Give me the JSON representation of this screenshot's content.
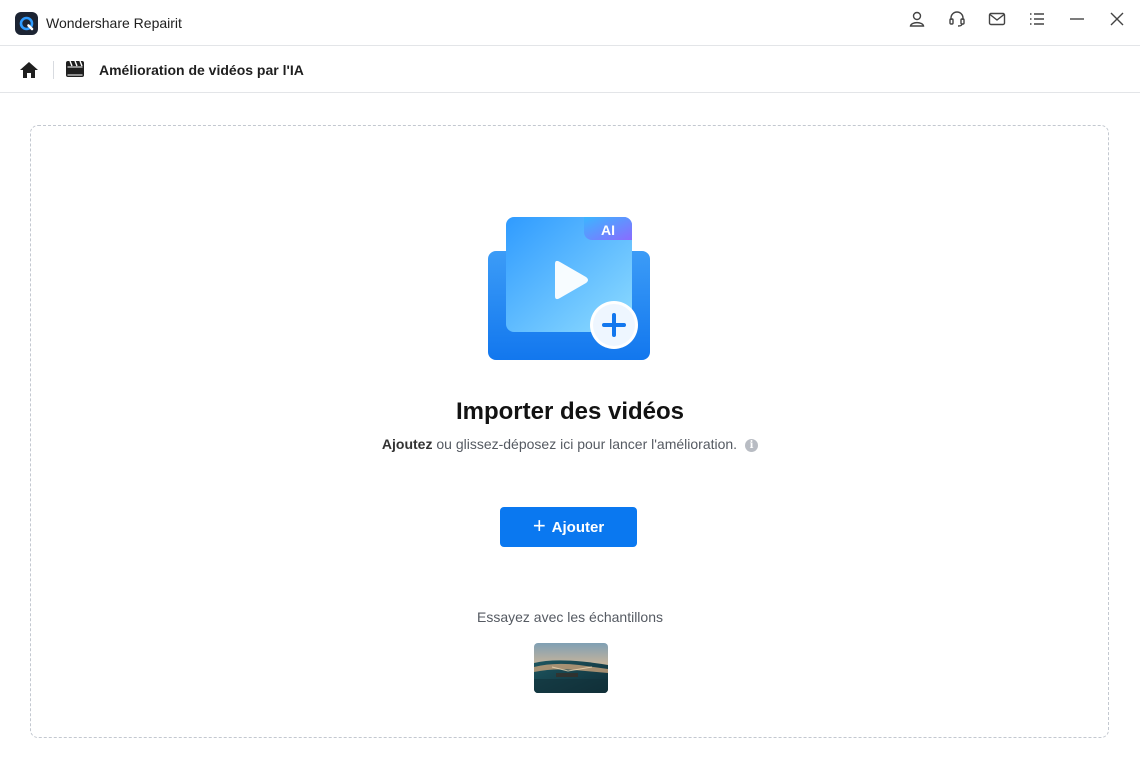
{
  "window": {
    "title": "Wondershare Repairit",
    "controls": [
      "account-icon",
      "support-headset-icon",
      "mail-icon",
      "menu-icon",
      "minimize-icon",
      "close-icon"
    ]
  },
  "breadcrumb": {
    "home_icon": "home-icon",
    "section_icon": "video-clapper-icon",
    "title": "Amélioration de vidéos par l'IA"
  },
  "dropzone": {
    "illustration_badge": "AI",
    "heading": "Importer des vidéos",
    "hint_strong": "Ajoutez",
    "hint_rest": " ou glissez-déposez ici pour lancer l'amélioration.",
    "info_icon": "i",
    "add_button_icon": "+",
    "add_button_label": "Ajouter",
    "samples_label": "Essayez avec les échantillons"
  },
  "colors": {
    "accent": "#0a78f0",
    "border_dashed": "#c3c8d0",
    "text_secondary": "#555a62"
  }
}
